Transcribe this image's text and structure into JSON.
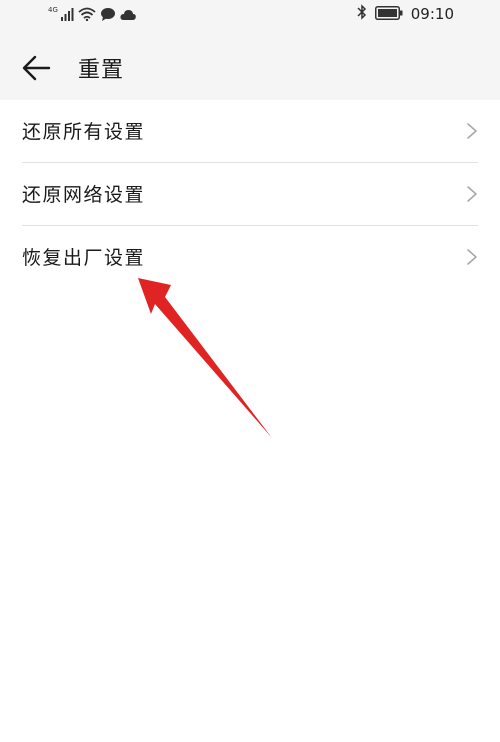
{
  "status_bar": {
    "network_label": "4G",
    "icons": [
      "signal-icon",
      "wifi-icon",
      "message-icon",
      "cloud-icon",
      "bluetooth-icon",
      "battery-icon"
    ],
    "time": "09:10"
  },
  "header": {
    "back_icon": "arrow-left-icon",
    "title": "重置"
  },
  "settings_list": {
    "items": [
      {
        "label": "还原所有设置"
      },
      {
        "label": "还原网络设置"
      },
      {
        "label": "恢复出厂设置"
      }
    ]
  },
  "annotation": {
    "color": "#e02424",
    "points_to": "恢复出厂设置"
  }
}
